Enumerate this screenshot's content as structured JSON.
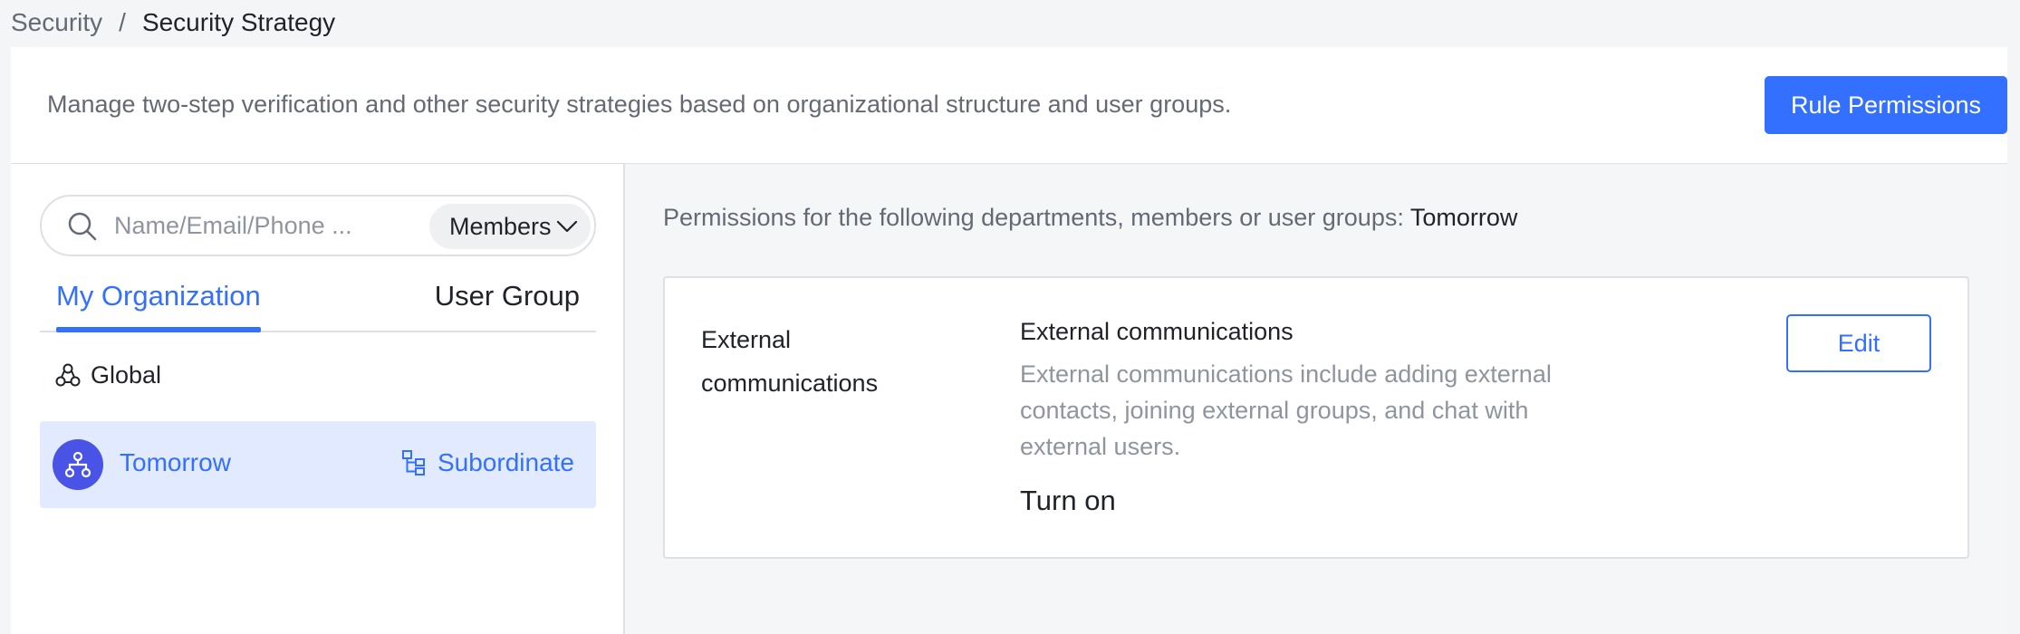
{
  "breadcrumb": {
    "parent": "Security",
    "separator": "/",
    "current": "Security Strategy"
  },
  "header": {
    "description": "Manage two-step verification and other security strategies based on organizational structure and user groups.",
    "rule_permissions_label": "Rule Permissions"
  },
  "left_pane": {
    "search": {
      "placeholder": "Name/Email/Phone ...",
      "value": "",
      "icon": "search-icon"
    },
    "filter": {
      "selected": "Members",
      "icon": "chevron-down-icon"
    },
    "tabs": [
      {
        "label": "My Organization",
        "active": true
      },
      {
        "label": "User Group",
        "active": false
      }
    ],
    "tree": {
      "global_label": "Global",
      "global_icon": "network-icon",
      "selected_label": "Tomorrow",
      "selected_icon": "org-chart-icon",
      "subordinate_label": "Subordinate",
      "subordinate_icon": "hierarchy-icon"
    }
  },
  "right_pane": {
    "permissions_prefix": "Permissions for the following departments, members or user groups:",
    "permissions_target": "Tomorrow",
    "policy": {
      "name": "External communications",
      "title": "External communications",
      "description": "External communications include adding external contacts, joining external groups, and chat with external users.",
      "status": "Turn on",
      "edit_label": "Edit"
    }
  },
  "colors": {
    "accent": "#3370ff",
    "selected_bg": "#e1eaff",
    "avatar": "#4954e6",
    "muted_text": "#646a73"
  }
}
